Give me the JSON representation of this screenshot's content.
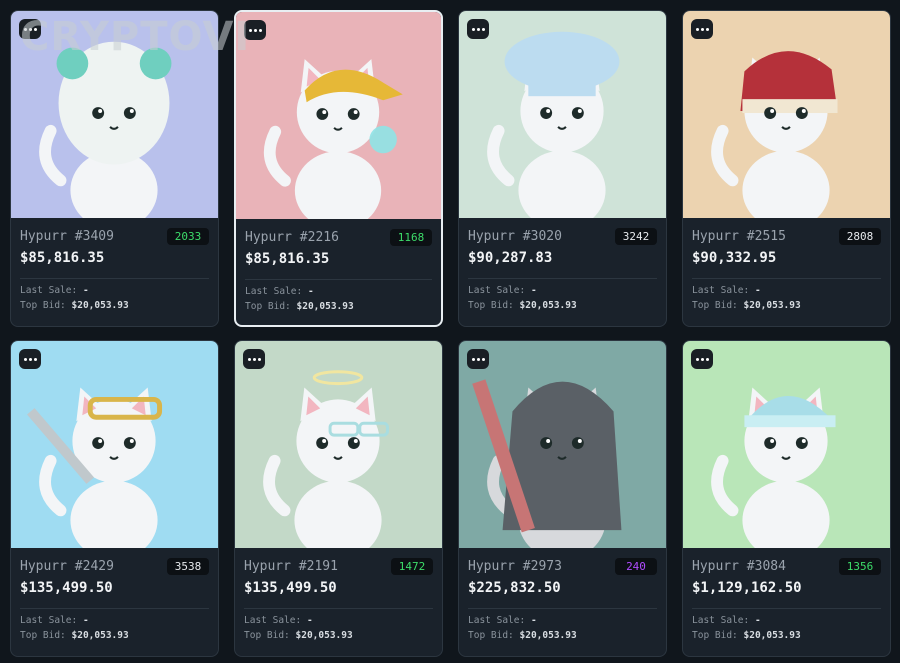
{
  "watermark": "CRYPTOVI",
  "labels": {
    "last_sale": "Last Sale:",
    "top_bid": "Top Bid:"
  },
  "cards": [
    {
      "name": "Hypurr #3409",
      "rank": "2033",
      "rank_color": "#3ddc6a",
      "price": "$85,816.35",
      "last_sale": "-",
      "top_bid": "$20,053.93",
      "bg": "#b9c1ec",
      "accent": "#6fcfbf",
      "fur": "#f3f5f7",
      "item_icon": "panda-hood-icon"
    },
    {
      "name": "Hypurr #2216",
      "rank": "1168",
      "rank_color": "#3ddc6a",
      "price": "$85,816.35",
      "last_sale": "-",
      "top_bid": "$20,053.93",
      "bg": "#e9b3b8",
      "accent": "#e6b837",
      "fur": "#f3f5f7",
      "item_icon": "yellow-cap-icon"
    },
    {
      "name": "Hypurr #3020",
      "rank": "3242",
      "rank_color": "#e6e9ec",
      "price": "$90,287.83",
      "last_sale": "-",
      "top_bid": "$20,053.93",
      "bg": "#cfe3d8",
      "accent": "#bcdcf0",
      "fur": "#f3f5f7",
      "item_icon": "chef-hat-icon"
    },
    {
      "name": "Hypurr #2515",
      "rank": "2808",
      "rank_color": "#e6e9ec",
      "price": "$90,332.95",
      "last_sale": "-",
      "top_bid": "$20,053.93",
      "bg": "#ecd3b0",
      "accent": "#b5313a",
      "fur": "#f3f5f7",
      "item_icon": "red-hat-icon"
    },
    {
      "name": "Hypurr #2429",
      "rank": "3538",
      "rank_color": "#e6e9ec",
      "price": "$135,499.50",
      "last_sale": "-",
      "top_bid": "$20,053.93",
      "bg": "#9fdcf2",
      "accent": "#d9b54a",
      "fur": "#f3f5f7",
      "item_icon": "goggles-icon"
    },
    {
      "name": "Hypurr #2191",
      "rank": "1472",
      "rank_color": "#3ddc6a",
      "price": "$135,499.50",
      "last_sale": "-",
      "top_bid": "$20,053.93",
      "bg": "#c3d9c8",
      "accent": "#a9dde0",
      "fur": "#f3f5f7",
      "item_icon": "halo-icon"
    },
    {
      "name": "Hypurr #2973",
      "rank": "240",
      "rank_color": "#b04cff",
      "price": "$225,832.50",
      "last_sale": "-",
      "top_bid": "$20,053.93",
      "bg": "#7fa9a5",
      "accent": "#5a6066",
      "fur": "#d7d9dc",
      "item_icon": "hooded-cloak-icon"
    },
    {
      "name": "Hypurr #3084",
      "rank": "1356",
      "rank_color": "#3ddc6a",
      "price": "$1,129,162.50",
      "last_sale": "-",
      "top_bid": "$20,053.93",
      "bg": "#b9e6b8",
      "accent": "#a8dde8",
      "fur": "#f3f5f7",
      "item_icon": "beanie-icon"
    }
  ]
}
